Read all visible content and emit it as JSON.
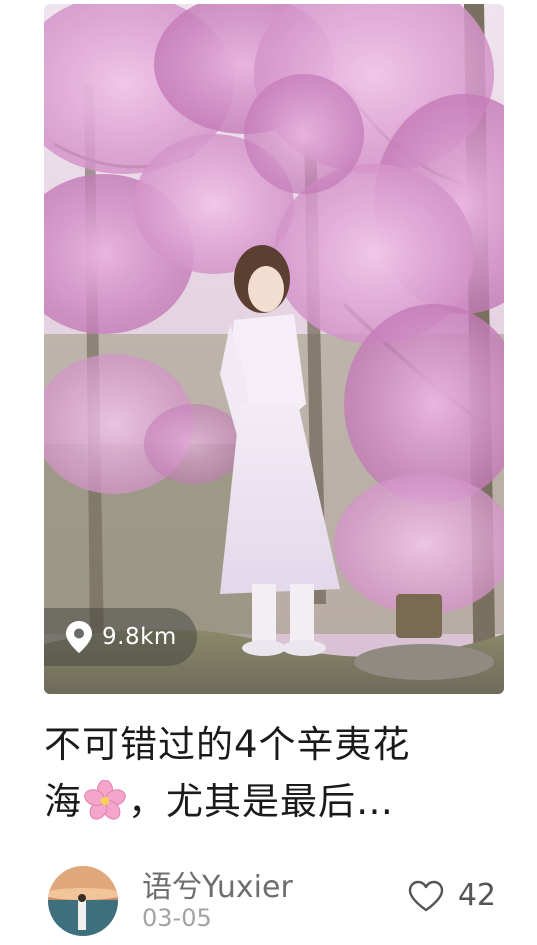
{
  "post": {
    "distance": "9.8km",
    "title": {
      "line1": "不可错过的4个辛夷花",
      "line2_prefix": "海",
      "line2_suffix": "，尤其是最后…"
    },
    "title_icon": "cherry-blossom-icon",
    "author": {
      "name": "语兮Yuxier",
      "date": "03-05"
    },
    "likes": {
      "count": "42",
      "icon": "heart-outline-icon"
    }
  },
  "colors": {
    "blossom_pink": "#d99ad1",
    "title_text": "#1a1a1a",
    "meta_text": "#a3a3a3",
    "author_text": "#6e6e6e"
  }
}
